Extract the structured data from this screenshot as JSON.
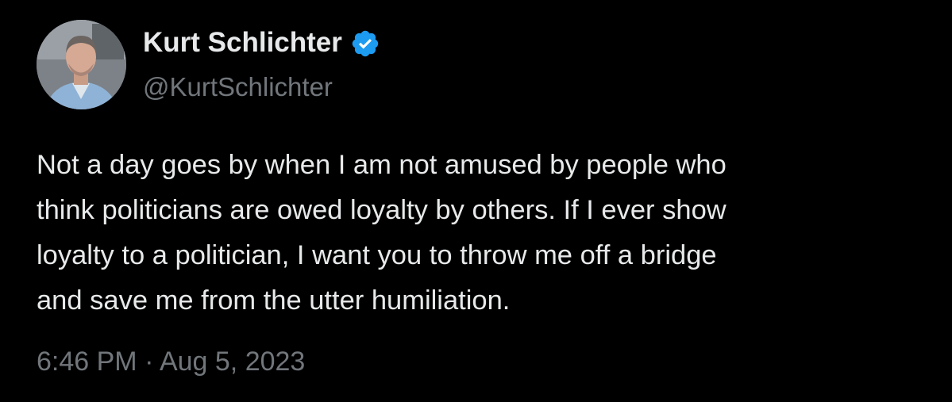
{
  "author": {
    "name": "Kurt Schlichter",
    "handle": "@KurtSchlichter",
    "verified_icon": "verified-badge-icon",
    "avatar_icon": "profile-photo"
  },
  "tweet": {
    "lines": [
      "Not a day goes by when I am not amused by people who",
      "think politicians are owed loyalty by others. If I ever show",
      "loyalty to a politician, I want you to throw me off a bridge",
      "and save me from the utter humiliation."
    ]
  },
  "meta": {
    "timestamp": "6:46 PM · Aug 5, 2023"
  },
  "colors": {
    "background": "#000000",
    "text_primary": "#e7e9ea",
    "text_secondary": "#71767b",
    "verified_blue": "#1d9bf0"
  }
}
